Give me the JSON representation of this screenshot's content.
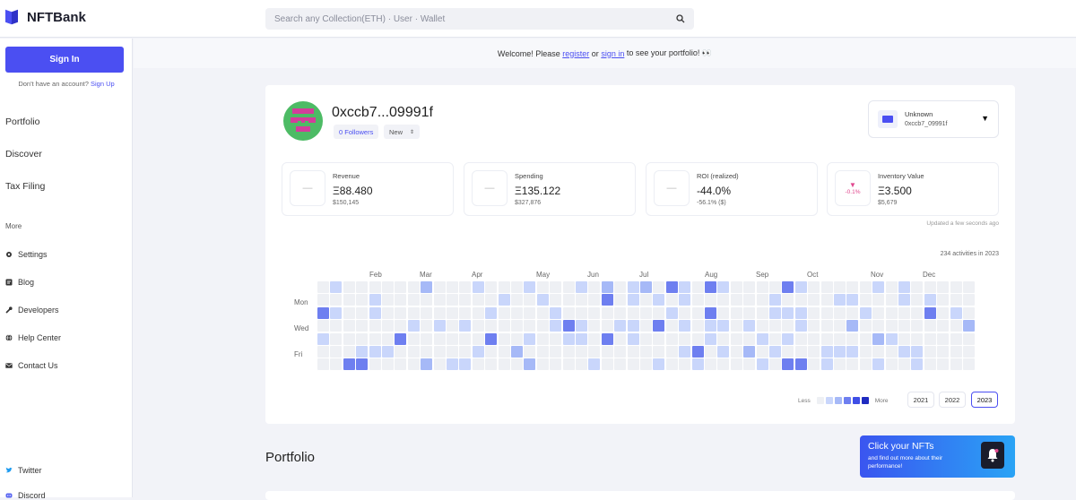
{
  "header": {
    "logo_text": "NFTBank",
    "search_placeholder": "Search any Collection(ETH) · User · Wallet"
  },
  "sidebar": {
    "signin_label": "Sign In",
    "no_account_text": "Don't have an account?",
    "signup_link": "Sign Up",
    "main_nav": [
      "Portfolio",
      "Discover",
      "Tax Filing"
    ],
    "more_label": "More",
    "sub_nav": [
      {
        "label": "Settings",
        "icon": "gear-icon"
      },
      {
        "label": "Blog",
        "icon": "blog-icon"
      },
      {
        "label": "Developers",
        "icon": "wrench-icon"
      },
      {
        "label": "Help Center",
        "icon": "globe-icon"
      },
      {
        "label": "Contact Us",
        "icon": "mail-icon"
      }
    ],
    "social": [
      {
        "label": "Twitter",
        "icon": "twitter-icon"
      },
      {
        "label": "Discord",
        "icon": "discord-icon"
      }
    ]
  },
  "welcome": {
    "before": "Welcome! Please",
    "register": "register",
    "or": "or",
    "signin": "sign in",
    "after": "to see your portfolio! 👀"
  },
  "profile": {
    "address": "0xccb7...09991f",
    "followers": "0 Followers",
    "tag": "New",
    "wallet_name": "Unknown",
    "wallet_address": "0xccb7_09991f"
  },
  "stats": [
    {
      "label": "Revenue",
      "value": "Ξ88.480",
      "sub": "$150,145",
      "icon": "—"
    },
    {
      "label": "Spending",
      "value": "Ξ135.122",
      "sub": "$327,876",
      "icon": "—"
    },
    {
      "label": "ROI (realized)",
      "value": "-44.0%",
      "sub": "-56.1% ($)",
      "icon": "—"
    },
    {
      "label": "Inventory Value",
      "value": "Ξ3.500",
      "sub": "$5,679",
      "icon": "-0.1%"
    }
  ],
  "updated_text": "Updated a few seconds ago",
  "activity": {
    "summary": "234 activities in 2023",
    "months": [
      "Feb",
      "Mar",
      "Apr",
      "May",
      "Jun",
      "Jul",
      "Aug",
      "Sep",
      "Oct",
      "Nov",
      "Dec"
    ],
    "days": [
      "Mon",
      "Wed",
      "Fri"
    ],
    "legend_less": "Less",
    "legend_more": "More",
    "colors": [
      "#eef0f4",
      "#c9d6fb",
      "#a6b9f7",
      "#6e7ff0",
      "#3f4fe6",
      "#1f2bc0"
    ],
    "years": [
      "2021",
      "2022",
      "2023"
    ],
    "active_year": "2023"
  },
  "portfolio_heading": "Portfolio",
  "promo": {
    "title": "Click your NFTs",
    "text": "and find out more about their performance!"
  }
}
